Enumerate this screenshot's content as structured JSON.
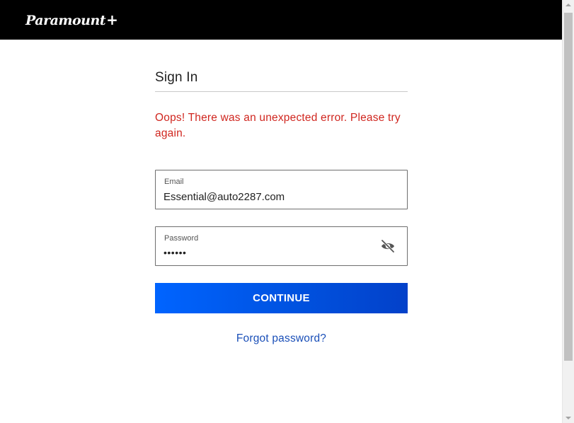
{
  "header": {
    "logo_text": "Paramount",
    "logo_plus": "+"
  },
  "signin": {
    "title": "Sign In",
    "error_message": "Oops! There was an unexpected error. Please try again.",
    "email": {
      "label": "Email",
      "value": "Essential@auto2287.com"
    },
    "password": {
      "label": "Password",
      "masked_value": "••••••",
      "toggle_icon": "eye-slash-icon"
    },
    "continue_label": "CONTINUE",
    "forgot_label": "Forgot password?"
  },
  "colors": {
    "header_bg": "#000000",
    "error": "#d0261f",
    "button_start": "#0064ff",
    "button_end": "#0341c9",
    "link": "#1a4fb8"
  }
}
